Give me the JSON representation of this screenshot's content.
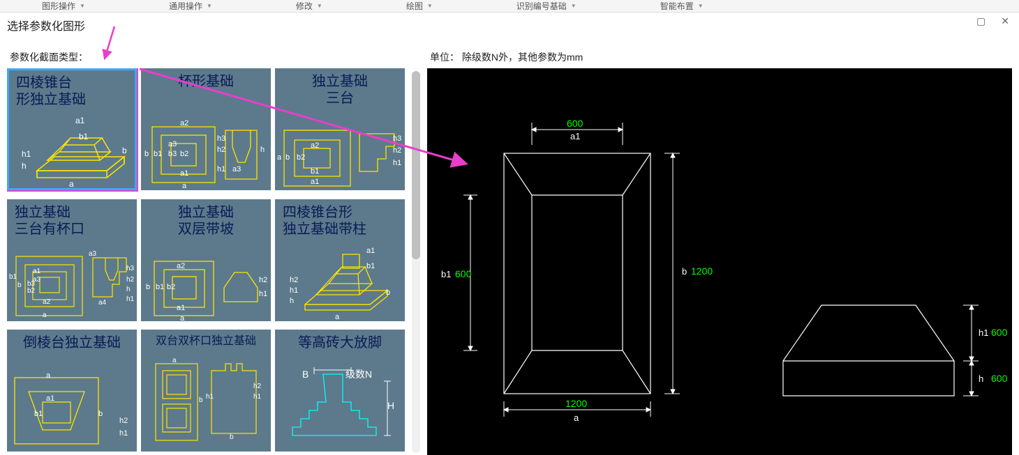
{
  "toolbar": {
    "items": [
      "图形操作",
      "通用操作",
      "修改",
      "绘图",
      "识别编号基础",
      "智能布置"
    ]
  },
  "window": {
    "title": "选择参数化图形",
    "maximize_glyph": "▢",
    "close_glyph": "✕"
  },
  "labels": {
    "section_type": "参数化截面类型：",
    "unit": "单位：   除级数N外，其他参数为mm"
  },
  "thumbs": [
    {
      "title": "四棱锥台\n形独立基础",
      "align": "left",
      "labels": [
        "a1",
        "b1",
        "b",
        "a",
        "h1",
        "h"
      ],
      "selected": true
    },
    {
      "title": "杯形基础",
      "align": "center",
      "labels": [
        "b",
        "b1",
        "a3",
        "b3",
        "a2",
        "b2",
        "h3",
        "h2",
        "h",
        "h1",
        "a3",
        "a1",
        "a"
      ]
    },
    {
      "title": "独立基础\n三台",
      "align": "center",
      "labels": [
        "a",
        "b",
        "b2",
        "a2",
        "b1",
        "a1",
        "h3",
        "h2",
        "h1"
      ]
    },
    {
      "title": "独立基础\n三台有杯口",
      "align": "left",
      "labels": [
        "b1",
        "b",
        "a1",
        "a3",
        "b3",
        "a2",
        "b2",
        "a",
        "a3",
        "a4",
        "h3",
        "h2",
        "h",
        "h1"
      ]
    },
    {
      "title": "独立基础\n双层带坡",
      "align": "center",
      "labels": [
        "b",
        "b1",
        "a2",
        "b2",
        "a1",
        "a",
        "h2",
        "h1"
      ]
    },
    {
      "title": "四棱锥台形\n独立基础带柱",
      "align": "left",
      "labels": [
        "a1",
        "b1",
        "a",
        "b",
        "h2",
        "h1",
        "h"
      ]
    },
    {
      "title": "倒棱台独立基础",
      "align": "center",
      "labels": [
        "a",
        "a1",
        "b1",
        "b",
        "h2",
        "h1"
      ]
    },
    {
      "title": "双台双杯口独立基础",
      "align": "center",
      "labels": [
        "a",
        "b",
        "h1",
        "h2",
        "h1",
        "b"
      ]
    },
    {
      "title": "等高砖大放脚",
      "align": "center",
      "labels": [
        "B",
        "级数N",
        "H"
      ]
    }
  ],
  "preview": {
    "a": {
      "label": "a",
      "value": "1200"
    },
    "a1": {
      "label": "a1",
      "value": "600"
    },
    "b": {
      "label": "b",
      "value": "1200"
    },
    "b1": {
      "label": "b1",
      "value": "600"
    },
    "h": {
      "label": "h",
      "value": "600"
    },
    "h1": {
      "label": "h1",
      "value": "600"
    }
  }
}
